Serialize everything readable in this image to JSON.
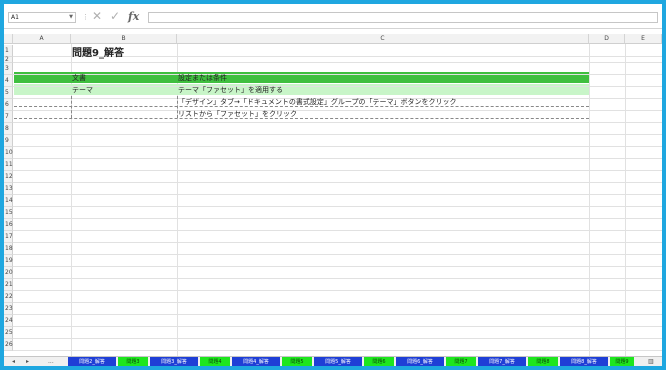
{
  "name_box": "A1",
  "formula": {
    "cancel_icon": "close-icon",
    "enter_icon": "check-icon",
    "fx_label": "fx",
    "content": ""
  },
  "columns": [
    "A",
    "B",
    "C",
    "D",
    "E"
  ],
  "rows": [
    "1",
    "2",
    "3",
    "4",
    "5",
    "6",
    "7",
    "8",
    "9",
    "10",
    "11",
    "12",
    "13",
    "14",
    "15",
    "16",
    "17",
    "18",
    "19",
    "20",
    "21",
    "22",
    "23",
    "24",
    "25",
    "26"
  ],
  "sheet": {
    "title": "問題9_解答",
    "table_headers": [
      "文書",
      "設定または条件"
    ],
    "rows": [
      {
        "b": "テーマ",
        "c": "テーマ「ファセット」を適用する"
      },
      {
        "b": "",
        "c": "「デザイン」タブ→「ドキュメントの書式設定」グループの「テーマ」ボタンをクリック"
      },
      {
        "b": "",
        "c": "リストから「ファセット」をクリック"
      }
    ]
  },
  "colors": {
    "header_band": "#3fbf3f",
    "first_row_band": "#c8f5c8",
    "tab_blue": "#1f3fd6",
    "tab_green": "#1ee61e",
    "window_border": "#1fa7e0"
  },
  "tabs": {
    "nav": [
      "◂",
      "▸",
      "..."
    ],
    "items": [
      {
        "label": "問題2_解答",
        "style": "blue"
      },
      {
        "label": "問題3",
        "style": "green"
      },
      {
        "label": "問題3_解答",
        "style": "blue"
      },
      {
        "label": "問題4",
        "style": "green"
      },
      {
        "label": "問題4_解答",
        "style": "blue"
      },
      {
        "label": "問題5",
        "style": "green"
      },
      {
        "label": "問題5_解答",
        "style": "blue"
      },
      {
        "label": "問題6",
        "style": "green"
      },
      {
        "label": "問題6_解答",
        "style": "blue"
      },
      {
        "label": "問題7",
        "style": "green"
      },
      {
        "label": "問題7_解答",
        "style": "blue"
      },
      {
        "label": "問題8",
        "style": "green"
      },
      {
        "label": "問題8_解答",
        "style": "blue"
      },
      {
        "label": "問題9",
        "style": "green"
      }
    ]
  }
}
